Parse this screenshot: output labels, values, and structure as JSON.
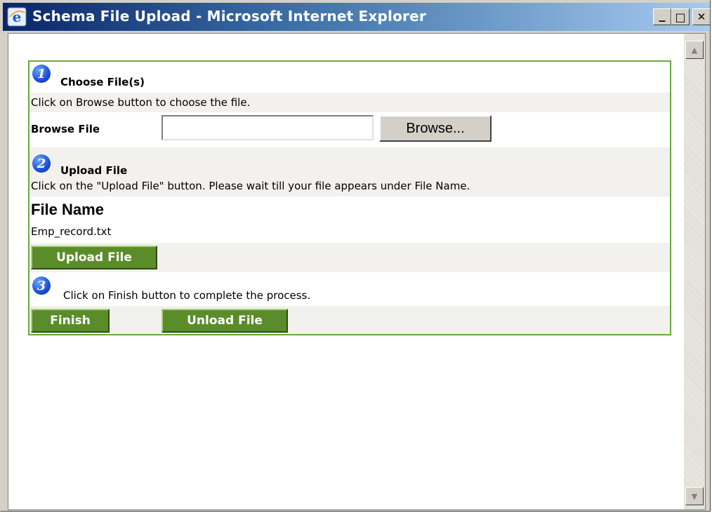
{
  "window": {
    "title": "Schema File Upload - Microsoft Internet Explorer",
    "minimize": "_",
    "maximize": "□",
    "close": "✕"
  },
  "step1": {
    "number": "1",
    "heading": "Choose File(s)",
    "instruction": "Click on Browse button to choose the file.",
    "browse_label": "Browse File",
    "file_input_value": "",
    "browse_button": "Browse..."
  },
  "step2": {
    "number": "2",
    "heading": "Upload File",
    "instruction": "Click on the \"Upload File\" button. Please wait till your file appears under File Name.",
    "file_name_header": "File Name",
    "file_name": "Emp_record.txt",
    "upload_button": "Upload File"
  },
  "step3": {
    "number": "3",
    "instruction": "Click on Finish button to complete the process.",
    "finish_button": "Finish",
    "unload_button": "Unload File"
  },
  "colors": {
    "panel_border": "#6aaa3a",
    "button_green": "#5b8c2a",
    "step_icon_blue": "#1a4fd6"
  }
}
